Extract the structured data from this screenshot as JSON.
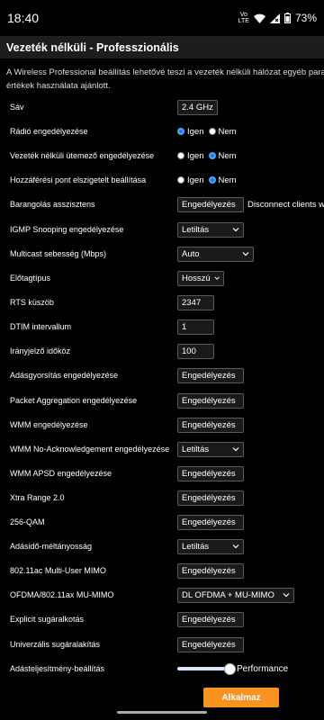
{
  "status": {
    "time": "18:40",
    "volte_line1": "Vo",
    "volte_line2": "LTE",
    "battery": "73%"
  },
  "page": {
    "title": "Vezeték nélküli - Professzionális",
    "desc_line1": "A Wireless Professional beállítás lehetővé teszi a vezeték nélküli hálózat egyéb paramé",
    "desc_line2": "értékek használata ajánlott."
  },
  "rows": [
    {
      "label": "Sáv",
      "type": "select",
      "value": "2.4 GHz"
    },
    {
      "label": "Rádió engedélyezése",
      "type": "radio",
      "options": [
        "Igen",
        "Nem"
      ],
      "selected": 0
    },
    {
      "label": "Vezeték nélküli ütemező engedélyezése",
      "type": "radio",
      "options": [
        "Igen",
        "Nem"
      ],
      "selected": 1
    },
    {
      "label": "Hozzáférési pont elszigetelt beállítása",
      "type": "radio",
      "options": [
        "Igen",
        "Nem"
      ],
      "selected": 1
    },
    {
      "label": "Barangolás asszisztens",
      "type": "select",
      "value": "Engedélyezés",
      "after": "Disconnect clients with"
    },
    {
      "label": "IGMP Snooping engedélyezése",
      "type": "select",
      "value": "Letiltás"
    },
    {
      "label": "Multicast sebesség (Mbps)",
      "type": "select",
      "value": "Auto"
    },
    {
      "label": "Előtagtípus",
      "type": "select",
      "value": "Hosszú"
    },
    {
      "label": "RTS küszöb",
      "type": "input",
      "value": "2347"
    },
    {
      "label": "DTIM intervallum",
      "type": "input",
      "value": "1"
    },
    {
      "label": "Irányjelző időköz",
      "type": "input",
      "value": "100"
    },
    {
      "label": "Adásgyorsítás engedélyezése",
      "type": "select",
      "value": "Engedélyezés"
    },
    {
      "label": "Packet Aggregation engedélyezése",
      "type": "select",
      "value": "Engedélyezés"
    },
    {
      "label": "WMM engedélyezése",
      "type": "select",
      "value": "Engedélyezés"
    },
    {
      "label": "WMM No-Acknowledgement engedélyezése",
      "type": "select",
      "value": "Letiltás"
    },
    {
      "label": "WMM APSD engedélyezése",
      "type": "select",
      "value": "Engedélyezés"
    },
    {
      "label": "Xtra Range 2.0",
      "type": "select",
      "value": "Engedélyezés"
    },
    {
      "label": "256-QAM",
      "type": "select",
      "value": "Engedélyezés"
    },
    {
      "label": "Adásidő-méltányosság",
      "type": "select",
      "value": "Letiltás"
    },
    {
      "label": "802.11ac Multi-User MIMO",
      "type": "select",
      "value": "Engedélyezés"
    },
    {
      "label": "OFDMA/802.11ax MU-MIMO",
      "type": "select",
      "value": "DL OFDMA + MU-MIMO"
    },
    {
      "label": "Explicit sugáralkotás",
      "type": "select",
      "value": "Engedélyezés"
    },
    {
      "label": "Univerzális sugáralakítás",
      "type": "select",
      "value": "Engedélyezés"
    },
    {
      "label": "Adásteljesítmény-beállítás",
      "type": "slider",
      "value_fraction": 0.95,
      "after": "Performance"
    }
  ],
  "apply_label": "Alkalmaz",
  "colors": {
    "accent": "#f7931e",
    "radio": "#1a73e8"
  }
}
